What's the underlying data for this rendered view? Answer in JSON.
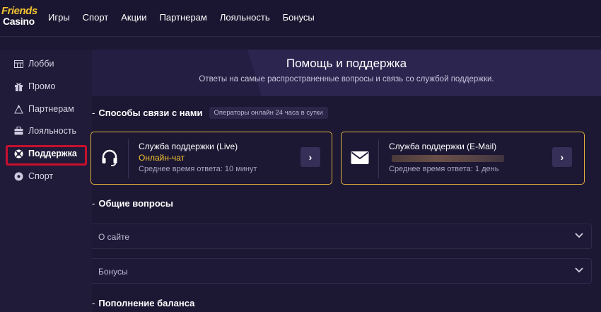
{
  "logo": {
    "line1": "Friends",
    "line2": "Casino"
  },
  "nav": [
    "Игры",
    "Спорт",
    "Акции",
    "Партнерам",
    "Лояльность",
    "Бонусы"
  ],
  "sidebar": {
    "items": [
      {
        "label": "Лобби",
        "icon": "lobby-icon"
      },
      {
        "label": "Промо",
        "icon": "gift-icon"
      },
      {
        "label": "Партнерам",
        "icon": "partners-icon"
      },
      {
        "label": "Лояльность",
        "icon": "briefcase-icon"
      },
      {
        "label": "Поддержка",
        "icon": "support-icon",
        "active": true
      },
      {
        "label": "Спорт",
        "icon": "soccer-ball-icon"
      }
    ],
    "highlight_color": "#c8102e"
  },
  "header": {
    "title": "Помощь и поддержка",
    "subtitle": "Ответы на самые распространенные вопросы и связь со службой поддержки."
  },
  "contact": {
    "title": "Способы связи с нами",
    "badge": "Операторы онлайн 24 часа в сутки",
    "live": {
      "title": "Служба поддержки (Live)",
      "link": "Онлайн-чат",
      "response": "Среднее время ответа: 10 минут"
    },
    "email": {
      "title": "Служба поддержки (E-Mail)",
      "response": "Среднее время ответа: 1 день"
    },
    "accent_color": "#e3b13a"
  },
  "faq": {
    "title": "Общие вопросы",
    "items": [
      "О сайте",
      "Бонусы"
    ]
  },
  "deposit": {
    "title": "Пополнение баланса"
  }
}
